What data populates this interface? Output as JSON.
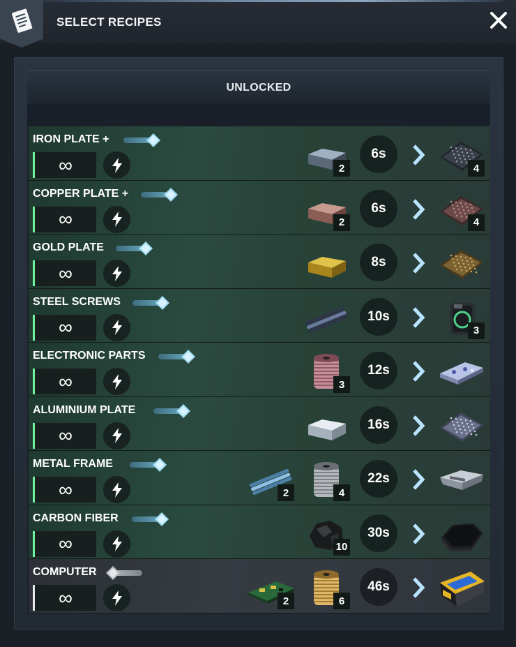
{
  "header": {
    "title": "SELECT RECIPES",
    "icon": "recipe-list-icon",
    "close_icon": "close-icon"
  },
  "section": {
    "title": "UNLOCKED"
  },
  "colors": {
    "active_row": "#284238",
    "locked_row": "#363b42",
    "active_bar": "#6ff29d",
    "toggle_on": "#6db1c8",
    "toggle_off": "#b9bec4"
  },
  "recipes": [
    {
      "name": "IRON PLATE +",
      "enabled": true,
      "count": "∞",
      "time": "6s",
      "inputs": [
        {
          "icon": "iron-ingot-icon",
          "qty": "2"
        }
      ],
      "output": {
        "icon": "iron-plate-icon",
        "qty": "4"
      }
    },
    {
      "name": "COPPER PLATE +",
      "enabled": true,
      "count": "∞",
      "time": "6s",
      "inputs": [
        {
          "icon": "copper-ingot-icon",
          "qty": "2"
        }
      ],
      "output": {
        "icon": "copper-plate-icon",
        "qty": "4"
      }
    },
    {
      "name": "GOLD PLATE",
      "enabled": true,
      "count": "∞",
      "time": "8s",
      "inputs": [
        {
          "icon": "gold-ingot-icon",
          "qty": ""
        }
      ],
      "output": {
        "icon": "gold-plate-icon",
        "qty": ""
      }
    },
    {
      "name": "STEEL SCREWS",
      "enabled": true,
      "count": "∞",
      "time": "10s",
      "inputs": [
        {
          "icon": "steel-rod-icon",
          "qty": ""
        }
      ],
      "output": {
        "icon": "steel-screws-icon",
        "qty": "3"
      }
    },
    {
      "name": "ELECTRONIC PARTS",
      "enabled": true,
      "count": "∞",
      "time": "12s",
      "inputs": [
        {
          "icon": "copper-wire-spool-icon",
          "qty": "3"
        }
      ],
      "output": {
        "icon": "electronic-parts-icon",
        "qty": ""
      }
    },
    {
      "name": "ALUMINIUM PLATE",
      "enabled": true,
      "count": "∞",
      "time": "16s",
      "inputs": [
        {
          "icon": "aluminium-ingot-icon",
          "qty": ""
        }
      ],
      "output": {
        "icon": "aluminium-plate-icon",
        "qty": ""
      }
    },
    {
      "name": "METAL FRAME",
      "enabled": true,
      "count": "∞",
      "time": "22s",
      "inputs": [
        {
          "icon": "metal-rods-icon",
          "qty": "2"
        },
        {
          "icon": "steel-wire-spool-icon",
          "qty": "4"
        }
      ],
      "output": {
        "icon": "metal-frame-icon",
        "qty": ""
      }
    },
    {
      "name": "CARBON FIBER",
      "enabled": true,
      "count": "∞",
      "time": "30s",
      "inputs": [
        {
          "icon": "coal-icon",
          "qty": "10"
        }
      ],
      "output": {
        "icon": "carbon-fiber-icon",
        "qty": ""
      }
    },
    {
      "name": "COMPUTER",
      "enabled": false,
      "count": "∞",
      "time": "46s",
      "inputs": [
        {
          "icon": "circuit-board-icon",
          "qty": "2"
        },
        {
          "icon": "gold-wire-spool-icon",
          "qty": "6"
        }
      ],
      "output": {
        "icon": "computer-icon",
        "qty": ""
      }
    }
  ]
}
